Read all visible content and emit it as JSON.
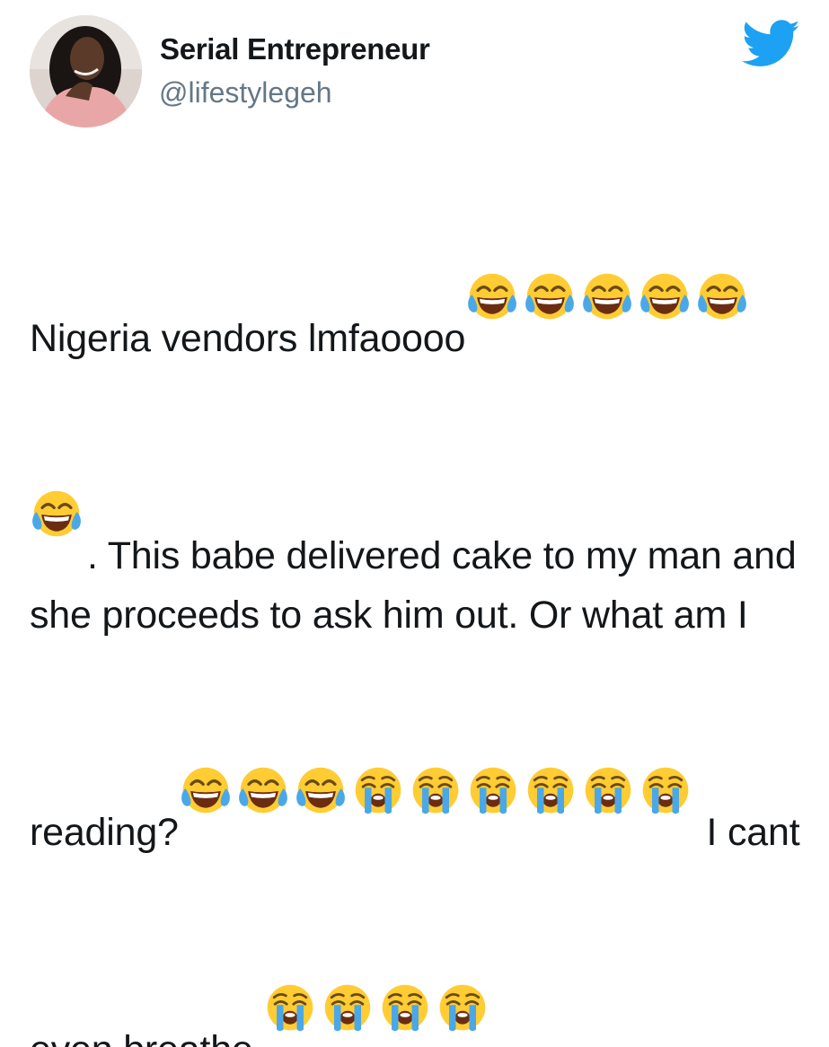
{
  "account": {
    "display_name": "Serial Entrepreneur",
    "handle": "@lifestylegeh"
  },
  "brand": {
    "icon": "twitter-bird-icon",
    "color": "#1da1f2"
  },
  "tweet": {
    "segments": [
      {
        "text": "Nigeria vendors lmfaoooo"
      },
      {
        "emoji": "face-with-tears-of-joy",
        "count": 6
      },
      {
        "text": ". This babe delivered cake to my man and she proceeds to ask him out. Or what am I reading?"
      },
      {
        "emoji": "face-with-tears-of-joy",
        "count": 3
      },
      {
        "emoji": "loudly-crying-face",
        "count": 6
      },
      {
        "text": " I cant even breathe "
      },
      {
        "emoji": "loudly-crying-face",
        "count": 4
      }
    ]
  }
}
